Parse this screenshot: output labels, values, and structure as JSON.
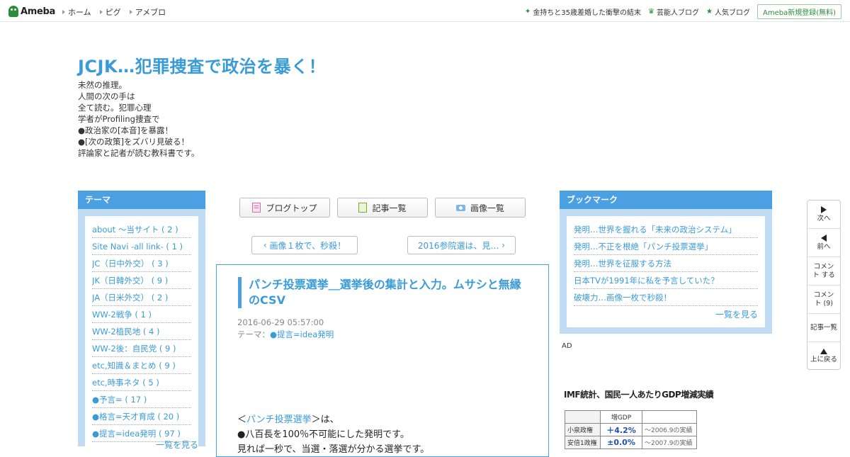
{
  "topbar": {
    "logo_text": "Ameba",
    "nav": [
      "ホーム",
      "ピグ",
      "アメブロ"
    ],
    "links": [
      "金持ちと35歳差婚した衝撃の結末",
      "芸能人ブログ",
      "人気ブログ"
    ],
    "signup": "Ameba新規登録(無料)"
  },
  "blog": {
    "title": "JCJK…犯罪捜査で政治を暴く！",
    "description": [
      "未然の推理。",
      "人間の次の手は",
      "全て読む。犯罪心理",
      "学者がProfiling捜査で",
      "●政治家の[本音]を暴露！",
      "●[次の政策]をズバリ見破る！",
      "評論家と記者が読む教科書です。"
    ]
  },
  "theme": {
    "heading": "テーマ",
    "items": [
      "about ～当サイト ( 2 )",
      "Site Navi -all link- ( 1 )",
      "JC（日中外交） ( 3 )",
      "JK（日韓外交） ( 9 )",
      "JA（日米外交） ( 2 )",
      "WW-2戦争 ( 1 )",
      "WW-2植民地 ( 4 )",
      "WW-2後：自民党 ( 9 )",
      "etc,知識＆まとめ ( 9 )",
      "etc,時事ネタ ( 5 )",
      "●予言= ( 17 )",
      "●格言=天才育成 ( 20 )",
      "●提言=idea発明 ( 97 )"
    ],
    "see_all": "一覧を見る"
  },
  "buttons": {
    "blog_top": "ブログトップ",
    "article_list": "記事一覧",
    "image_list": "画像一覧"
  },
  "pager": {
    "prev": "画像１枚で、秒殺！",
    "next": "2016参院選は、見…"
  },
  "article": {
    "title": "パンチ投票選挙＿選挙後の集計と入力。ムサシと無縁のCSV",
    "date": "2016-06-29 05:57:00",
    "theme_label": "テーマ：",
    "theme_link": "●提言=idea発明",
    "body_prefix": "＜",
    "body_link": "パンチ投票選挙",
    "body_suffix": "＞は、",
    "body_line2": "●八百長を100％不可能にした発明です。",
    "body_line3": "見れば一秒で、当選・落選が分かる選挙です。"
  },
  "bookmark": {
    "heading": "ブックマーク",
    "items": [
      "発明…世界を握れる「未来の政治システム」",
      "発明…不正を根絶「パンチ投票選挙」",
      "発明…世界を征服する方法",
      "日本TVが1991年に私を予言していた？",
      "破壊力…画像一枚で秒殺！"
    ],
    "see_all": "一覧を見る"
  },
  "ad": {
    "label": "AD",
    "image_title": "IMF統計、国民一人あたりGDP増減実績",
    "header": "増GDP",
    "rows": [
      {
        "name": "小泉政権",
        "value": "＋4.2%",
        "note": "～2006.9の実績"
      },
      {
        "name": "安倍1政権",
        "value": "±0.0%",
        "note": "～2007.9の実績"
      }
    ]
  },
  "float_nav": {
    "next": "次へ",
    "prev": "前へ",
    "comment_do": "コメント する",
    "comments": "コメント (9)",
    "article_list": "記事一覧",
    "top": "上に戻る"
  }
}
